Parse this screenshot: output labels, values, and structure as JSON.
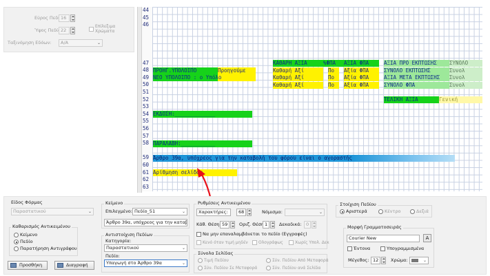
{
  "top_panel": {
    "label_width": "Εύρος Πεδίου:",
    "value_width": "16",
    "label_height": "Ύψος Πεδίου:",
    "value_height": "22",
    "checkbox_label_line1": "Επίλεξιμα",
    "checkbox_label_line2": "Χρώματα",
    "label_sort": "Ταξινόμηση Εδόων:",
    "value_sort": "Α/Α"
  },
  "grid": {
    "row_numbers": [
      "44",
      "45",
      "46",
      "47",
      "48",
      "49",
      "50",
      "51",
      "52",
      "53",
      "54",
      "55",
      "56",
      "57",
      "58",
      "59",
      "60",
      "61",
      "62",
      "63"
    ],
    "row47": {
      "a": "ΚΑΘΑΡΗ ΑΞΙΑ",
      "b": "%ΦΠΑ",
      "c": "ΑΞΙΑ ΦΠΑ",
      "d": "ΑΞΙΑ ΠΡΟ ΕΚΠΤΩΣΗΣ",
      "e": "ΣΥΝΟΛΟ"
    },
    "row48": {
      "a": "ΠΡΟΗΓ.ΥΠΟΛΟΙΠΟ",
      "b": "Προηγούμε",
      "c": "Καθαρή Αξί",
      "d": "Πο",
      "e": "Αξία ΦΠΑ",
      "f": "ΣΥΝΟΛΟ ΕΚΠΤΩΣΗΣ",
      "g": "Συνολ"
    },
    "row49": {
      "a": "ΝΕΟ ΥΠΟΛΟΙΠΟ  : ο Υπόλο",
      "c": "Καθαρή Αξί",
      "d": "Πο",
      "e": "Αξία ΦΠΑ",
      "f": "ΑΞΙΑ ΜΕΤΑ ΕΚΠΤΩΣΗΣ",
      "g": "Συνολ"
    },
    "row50": {
      "c": "Καθαρή Αξί",
      "d": "Πο",
      "e": "Αξία ΦΠΑ",
      "f": "ΣΥΝΟΛΟ ΦΠΑ",
      "g": "Συνολ"
    },
    "row52": {
      "a": "ΤΕΛΙΚΗ ΑΞΙΑ",
      "b": "Γενική"
    },
    "row54": "ΕΚΔΟΣΗ:_____________",
    "row57": "ΠΑΡΑΛΑΒΗ:___________",
    "row59": "Άρθρο 39α, υπόχρεος για την καταβολή του φόρου είναι ο αγοραστής",
    "row61": "Αρίθμηση σελίδας"
  },
  "bottom": {
    "form_type": {
      "title": "Είδος Φόρμας",
      "value": "Παραστατικού"
    },
    "clear_obj": {
      "title": "Καθαρισμός Αντικειμένου",
      "opt1": "Κείμενο",
      "opt2": "Πεδίο",
      "opt3": "Παρατήρηση Αντιγράφου"
    },
    "btn_add": "Προσθήκη",
    "btn_delete": "Διαγραφή",
    "text_group": {
      "title": "Κείμενο",
      "selected_label": "Επιλεγμένο:",
      "selected_value": "Πεδίο_51",
      "text_value": "Άρθρο 39α, υπόχρεος για την καταβο"
    },
    "field_map": {
      "title": "Αντιστοίχιση Πεδίων",
      "category_label": "Κατηγορία:",
      "category_value": "Παραστατικού",
      "field_label": "Πεδίο:",
      "field_value": "Υπαγωγή στο Άρθρο 39α"
    },
    "text_settings": {
      "title": "Ρυθμίσεις Αντικειμένου",
      "chars_label": "Χαρακτήρες:",
      "chars_value": "68",
      "currency_label": "Νόμισμα:",
      "vpos_label": "Κάθ. Θέση:",
      "vpos_value": "59",
      "hpos_label": "Οριζ. Θέση:",
      "hpos_value": "1",
      "decimals_label": "Δεκαδικά:",
      "decimals_value": "0",
      "no_repeat": "Να μην επαναλαμβάνεται το πεδίο (Εγγραφές)",
      "empty_zero": "Κενό όταν τιμή μηδέν",
      "words": "Ολογράφως",
      "no_dec": "Χωρίς Υπολ. Δεκ"
    },
    "sums": {
      "title": "Σύνολα Σελίδας",
      "opt1": "Τιμή Πεδίου",
      "opt2": "Σύν. Πεδίου Από Μεταφορά",
      "opt3": "Σύν. Πεδίου Σε Μεταφορά",
      "opt4": "Σύν. Πεδίου ανά Σελίδα"
    },
    "align": {
      "title": "Στοίχιση Πεδίου",
      "left": "Αριστερά",
      "center": "Κέντρο",
      "right": "Δεξιά"
    },
    "font": {
      "title": "Μορφή Γραμματοσειράς",
      "value": "Courier New",
      "bold": "Έντονα",
      "underline": "Υπογραμμισμένα",
      "size_label": "Μέγεθος:",
      "size_value": "12",
      "color_label": "Χρώμα:"
    }
  },
  "colors": {
    "accent_green": "#16d21a",
    "accent_yellow": "#fff200",
    "accent_blue": "#1e95d8",
    "arrow_red": "#e8101a"
  }
}
